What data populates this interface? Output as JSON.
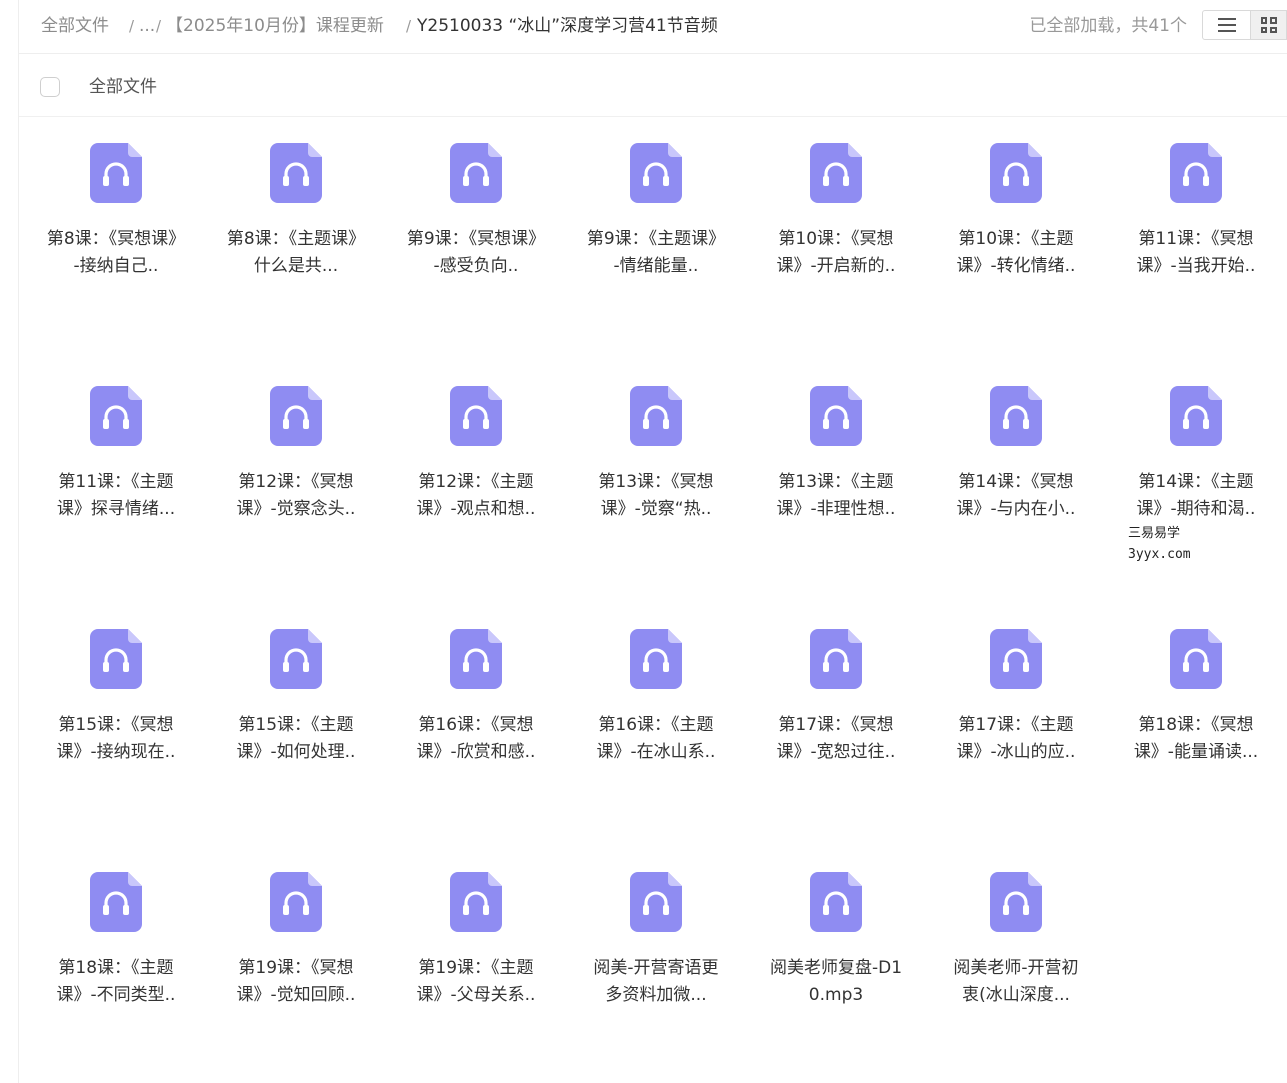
{
  "breadcrumb": {
    "root": "全部文件",
    "ellipsis": "...",
    "sep": "/",
    "parent": "【2025年10月份】课程更新",
    "current": "Y2510033 “冰山”深度学习营41节音频"
  },
  "status": {
    "loaded_text": "已全部加载，共41个"
  },
  "list_header": {
    "label": "全部文件"
  },
  "colors": {
    "icon": "#8f8cf2",
    "icon_fold": "#c9c7fb"
  },
  "watermark": {
    "line1": "三易易学",
    "line2": "3yyx.com"
  },
  "files": [
    {
      "name": "第8课：《冥想课》-接纳自己.."
    },
    {
      "name": "第8课：《主题课》什么是共..."
    },
    {
      "name": "第9课：《冥想课》-感受负向.."
    },
    {
      "name": "第9课：《主题课》-情绪能量.."
    },
    {
      "name": "第10课：《冥想课》-开启新的.."
    },
    {
      "name": "第10课：《主题课》-转化情绪.."
    },
    {
      "name": "第11课：《冥想课》-当我开始.."
    },
    {
      "name": "第11课：《主题课》探寻情绪..."
    },
    {
      "name": "第12课：《冥想课》-觉察念头.."
    },
    {
      "name": "第12课：《主题课》-观点和想.."
    },
    {
      "name": "第13课：《冥想课》-觉察“热.."
    },
    {
      "name": "第13课：《主题课》-非理性想.."
    },
    {
      "name": "第14课：《冥想课》-与内在小.."
    },
    {
      "name": "第14课：《主题课》-期待和渴.."
    },
    {
      "name": "第15课：《冥想课》-接纳现在.."
    },
    {
      "name": "第15课：《主题课》-如何处理.."
    },
    {
      "name": "第16课：《冥想课》-欣赏和感.."
    },
    {
      "name": "第16课：《主题课》-在冰山系.."
    },
    {
      "name": "第17课：《冥想课》-宽恕过往.."
    },
    {
      "name": "第17课：《主题课》-冰山的应.."
    },
    {
      "name": "第18课：《冥想课》-能量诵读..."
    },
    {
      "name": "第18课：《主题课》-不同类型.."
    },
    {
      "name": "第19课：《冥想课》-觉知回顾.."
    },
    {
      "name": "第19课：《主题课》-父母关系.."
    },
    {
      "name": "阅美-开营寄语更多资料加微..."
    },
    {
      "name": "阅美老师复盘-D10.mp3"
    },
    {
      "name": "阅美老师-开营初衷(冰山深度..."
    }
  ]
}
